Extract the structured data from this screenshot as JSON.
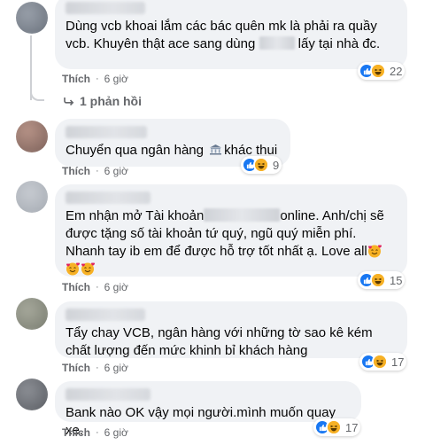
{
  "comments": [
    {
      "text_before": "Dùng vcb khoai lắm các bác quên mk là phải ra quầy vcb. Khuyên thật ace sang dùng ",
      "text_after": " lấy tại nhà đc.",
      "like_label": "Thích",
      "dot": "·",
      "time": "6 giờ",
      "reaction_count": "22",
      "replies_label": "1 phản hồi"
    },
    {
      "text_before": "Chuyển qua ngân hàng",
      "text_after": "khác thui",
      "like_label": "Thích",
      "dot": "·",
      "time": "6 giờ",
      "reaction_count": "9"
    },
    {
      "text_before": "Em nhận mở Tài khoản",
      "text_after": "online. Anh/chị sẽ được tặng số tài khoản tứ quý, ngũ quý miễn phí. Nhanh tay ib em để được hỗ trợ tốt nhất ạ. Love all",
      "like_label": "Thích",
      "dot": "·",
      "time": "6 giờ",
      "reaction_count": "15"
    },
    {
      "text": "Tẩy chay VCB, ngân hàng với những tờ sao kê kém chất lượng đến mức khinh bỉ khách hàng",
      "like_label": "Thích",
      "dot": "·",
      "time": "6 giờ",
      "reaction_count": "17"
    },
    {
      "text": "Bank nào OK vậy mọi người.mình muốn quay xe.",
      "like_label": "Thích",
      "dot": "·",
      "time": "6 giờ",
      "reaction_count": "17"
    }
  ],
  "icons": {
    "like": "like-reaction-icon",
    "haha": "haha-reaction-icon",
    "bank": "bank-emoji-icon",
    "love": "smiling-hearts-emoji-icon",
    "reply": "reply-arrow-icon"
  },
  "colors": {
    "bubble": "#f0f2f5",
    "meta_text": "#65676b",
    "like_blue": "#1877f2",
    "haha_yellow": "#f7b125"
  }
}
